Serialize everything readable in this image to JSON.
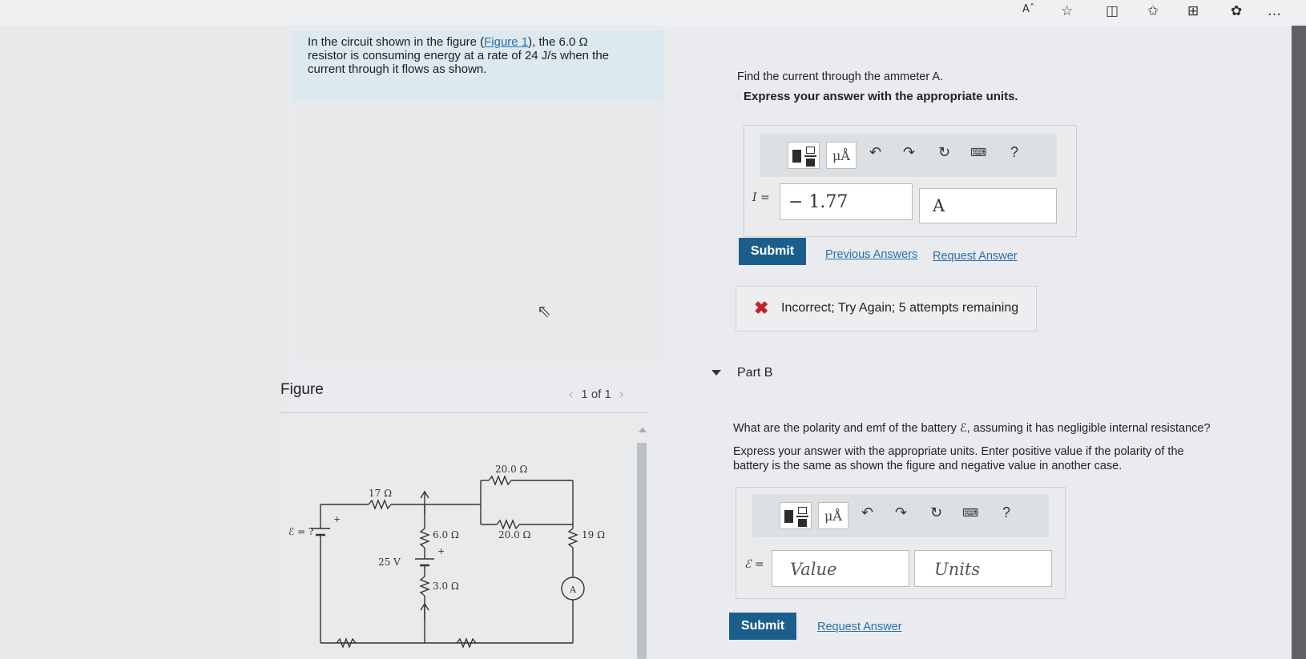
{
  "browser": {
    "font_size_label": "Aˆ",
    "more_label": "…"
  },
  "problem": {
    "line1_pre": "In the circuit shown in the figure (",
    "figure_link": "Figure 1",
    "line1_post": "), the 6.0 Ω",
    "line2": "resistor is consuming energy at a rate of 24 J/s when the",
    "line3": "current through it flows as shown."
  },
  "figure": {
    "title": "Figure",
    "pager": "1 of 1",
    "labels": {
      "r20_top": "20.0 Ω",
      "r17": "17 Ω",
      "emf": "ℰ = ?",
      "plus1": "+",
      "r6": "6.0 Ω",
      "r20_mid": "20.0 Ω",
      "r19": "19 Ω",
      "v25": "25 V",
      "plus2": "+",
      "r3": "3.0 Ω",
      "ammeter": "A"
    }
  },
  "partA": {
    "question": "Find the current through the ammeter A.",
    "instruction": "Express your answer with the appropriate units.",
    "toolbar": {
      "units_btn": "μÅ",
      "help": "?"
    },
    "var_label": "I =",
    "value": "− 1.77",
    "units": "A",
    "submit": "Submit",
    "previous_answers": "Previous Answers",
    "request_answer": "Request Answer",
    "feedback": "Incorrect; Try Again; 5 attempts remaining"
  },
  "partB": {
    "label": "Part B",
    "question": "What are the polarity and emf of the battery ℰ, assuming it has negligible internal resistance?",
    "instruction_line1": "Express your answer with the appropriate units. Enter positive value if the polarity of the",
    "instruction_line2": "battery is the same as shown the figure and negative value in another case.",
    "toolbar": {
      "units_btn": "μÅ",
      "help": "?"
    },
    "var_label": "ℰ =",
    "value_placeholder": "Value",
    "units_placeholder": "Units",
    "submit": "Submit",
    "request_answer": "Request Answer"
  },
  "colors": {
    "submit_bg": "#1b5e8c",
    "link": "#2a6fa8",
    "error": "#c0242b",
    "problem_bg": "#dce9ef"
  }
}
